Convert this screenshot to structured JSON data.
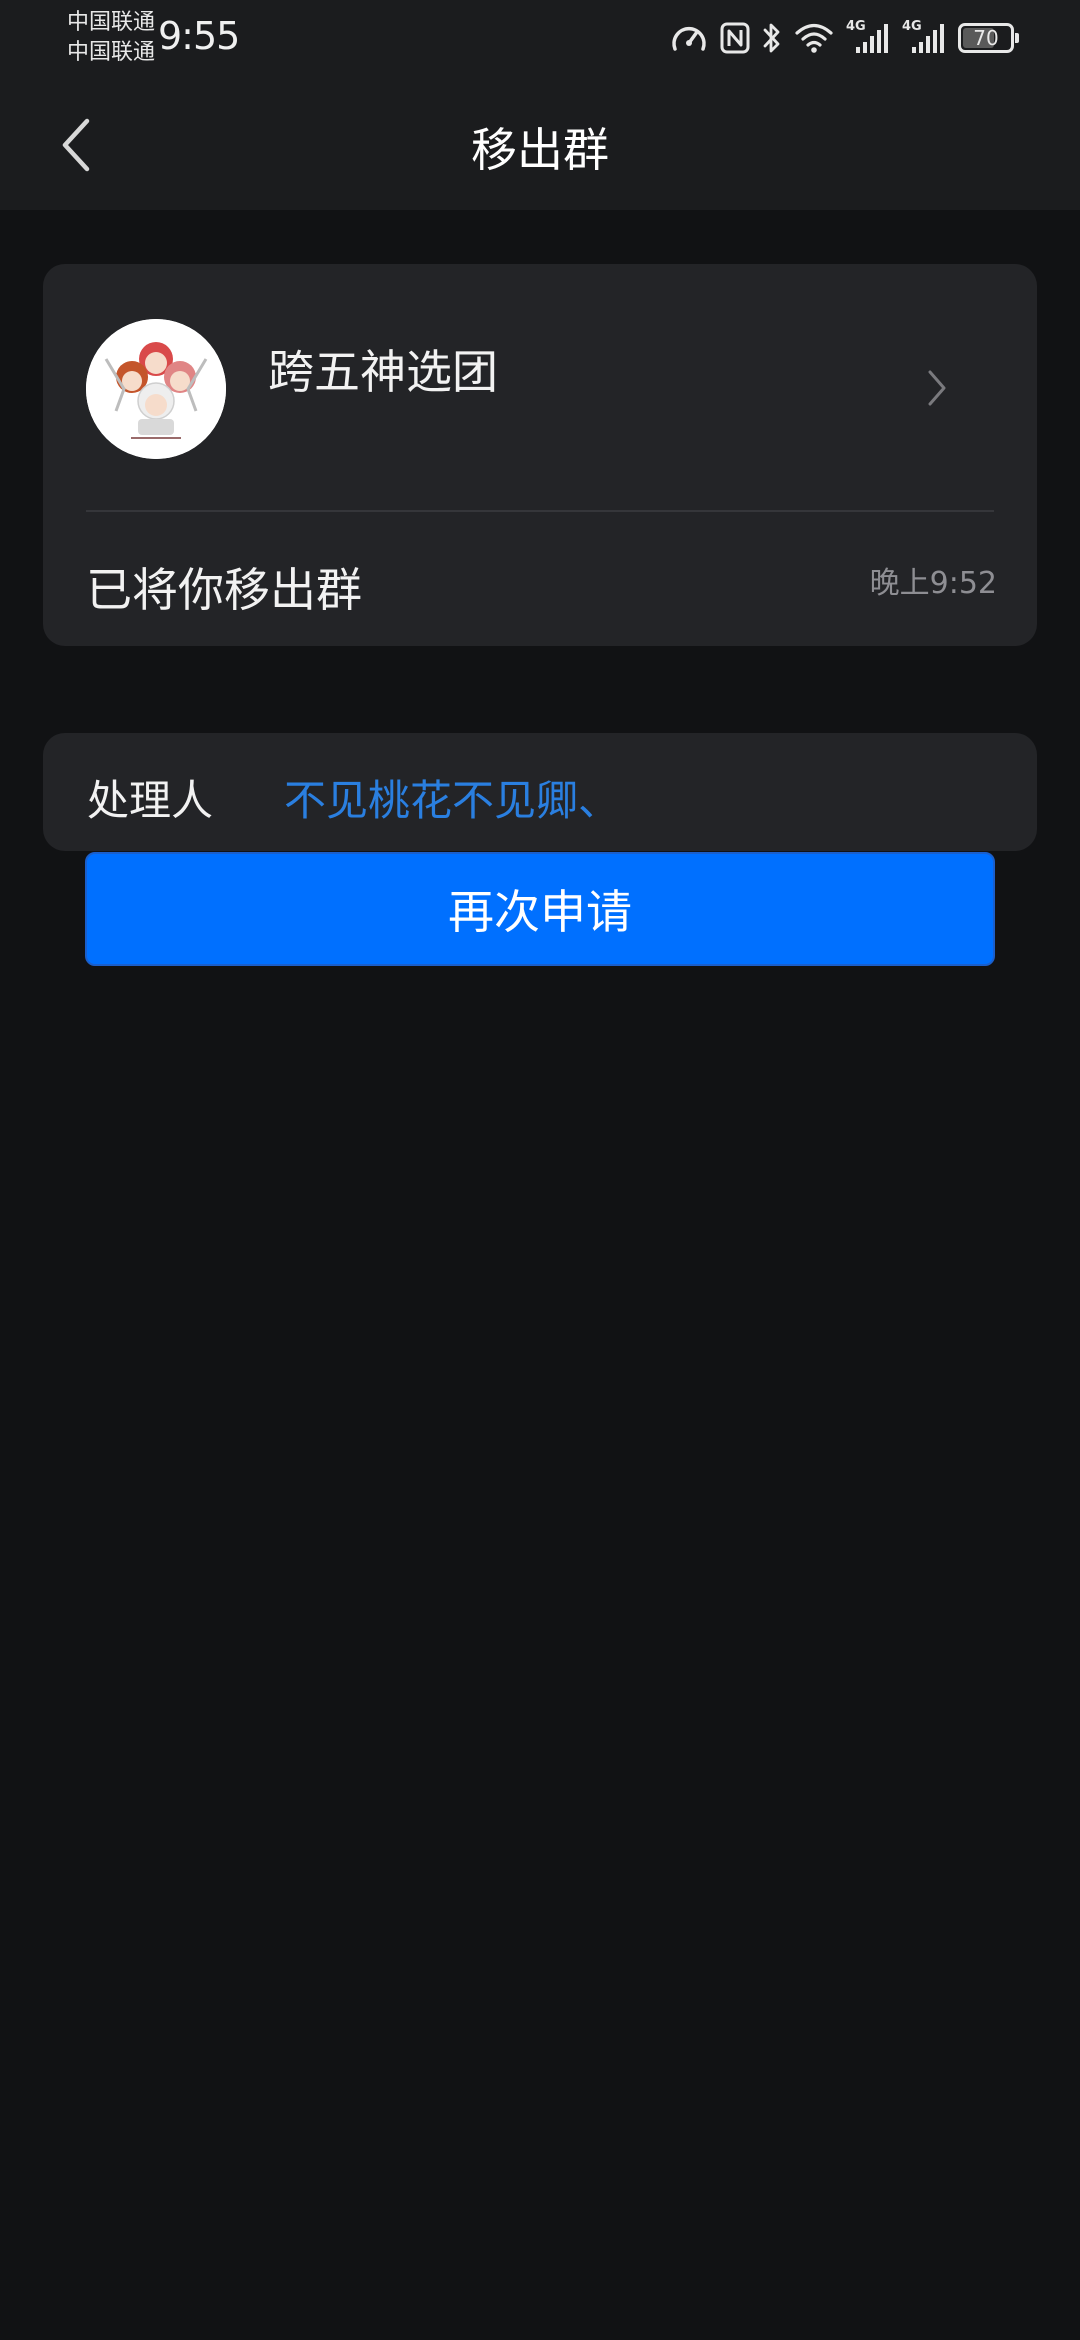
{
  "status_bar": {
    "carrier_1": "中国联通",
    "carrier_2": "中国联通",
    "time": "9:55",
    "network_1": "4G",
    "network_2": "4G",
    "battery_level": "70",
    "battery_fraction": 0.7
  },
  "nav": {
    "title": "移出群"
  },
  "group": {
    "name": "跨五神选团",
    "avatar_caption": "跨五神选团",
    "notice": "已将你移出群",
    "time": "晚上9:52"
  },
  "handler": {
    "label": "处理人",
    "name": "不见桃花不见卿、"
  },
  "actions": {
    "reapply_label": "再次申请"
  },
  "colors": {
    "background": "#111214",
    "card": "#232427",
    "accent_link": "#2a7fe0",
    "primary_button": "#0070ff"
  }
}
